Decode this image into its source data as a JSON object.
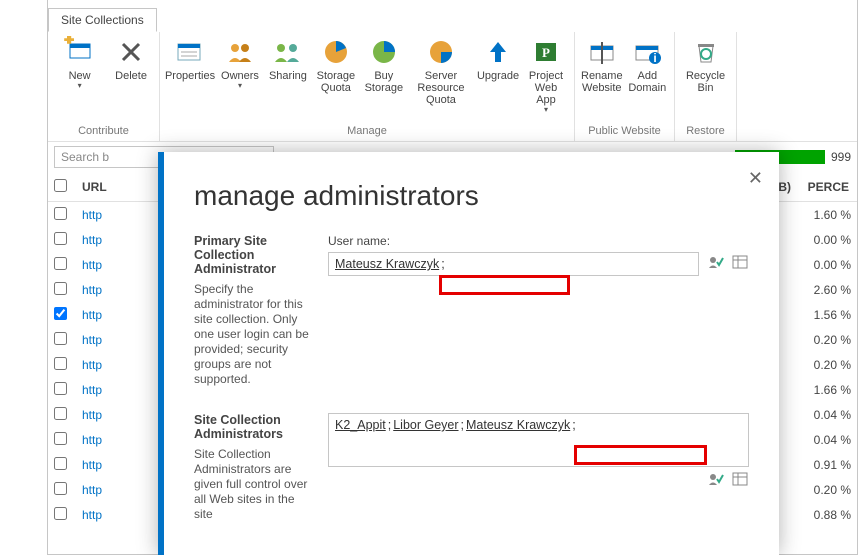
{
  "tab": {
    "label": "Site Collections"
  },
  "ribbon": {
    "contribute": {
      "label": "Contribute",
      "new": "New",
      "delete": "Delete"
    },
    "manage": {
      "label": "Manage",
      "properties": "Properties",
      "owners": "Owners",
      "sharing": "Sharing",
      "storage_quota": "Storage Quota",
      "buy_storage": "Buy Storage",
      "server_quota": "Server Resource Quota",
      "upgrade": "Upgrade",
      "project_web": "Project Web App"
    },
    "public": {
      "label": "Public Website",
      "rename": "Rename Website",
      "add_domain": "Add Domain"
    },
    "restore": {
      "label": "Restore",
      "recycle": "Recycle Bin"
    }
  },
  "search": {
    "placeholder": "Search b"
  },
  "quota": {
    "available": "999"
  },
  "columns": {
    "url": "URL",
    "limit": "LIMIT (GB)",
    "perc": "PERCE"
  },
  "rows": [
    {
      "url": "http",
      "limit": "",
      "perc": "1.60 %",
      "checked": false
    },
    {
      "url": "http",
      "limit": "",
      "perc": "0.00 %",
      "checked": false
    },
    {
      "url": "http",
      "limit": "",
      "perc": "0.00 %",
      "checked": false
    },
    {
      "url": "http",
      "limit": "",
      "perc": "2.60 %",
      "checked": false
    },
    {
      "url": "http",
      "limit": "",
      "perc": "1.56 %",
      "checked": true
    },
    {
      "url": "http",
      "limit": "",
      "perc": "0.20 %",
      "checked": false
    },
    {
      "url": "http",
      "limit": "",
      "perc": "0.20 %",
      "checked": false
    },
    {
      "url": "http",
      "limit": "",
      "perc": "1.66 %",
      "checked": false
    },
    {
      "url": "http",
      "limit": "",
      "perc": "0.04 %",
      "checked": false
    },
    {
      "url": "http",
      "limit": "",
      "perc": "0.04 %",
      "checked": false
    },
    {
      "url": "http",
      "limit": "",
      "perc": "0.91 %",
      "checked": false
    },
    {
      "url": "http",
      "limit": "",
      "perc": "0.20 %",
      "checked": false
    },
    {
      "url": "http",
      "limit": "",
      "perc": "0.88 %",
      "checked": false
    }
  ],
  "modal": {
    "title": "manage administrators",
    "primary": {
      "title": "Primary Site Collection Administrator",
      "desc": "Specify the administrator for this site collection. Only one user login can be provided; security groups are not supported.",
      "field_label": "User name:",
      "user": "Mateusz Krawczyk"
    },
    "secondary": {
      "title": "Site Collection Administrators",
      "desc": "Site Collection Administrators are given full control over all Web sites in the site",
      "users": [
        "K2_Appit",
        "Libor Geyer",
        "Mateusz Krawczyk"
      ]
    }
  }
}
